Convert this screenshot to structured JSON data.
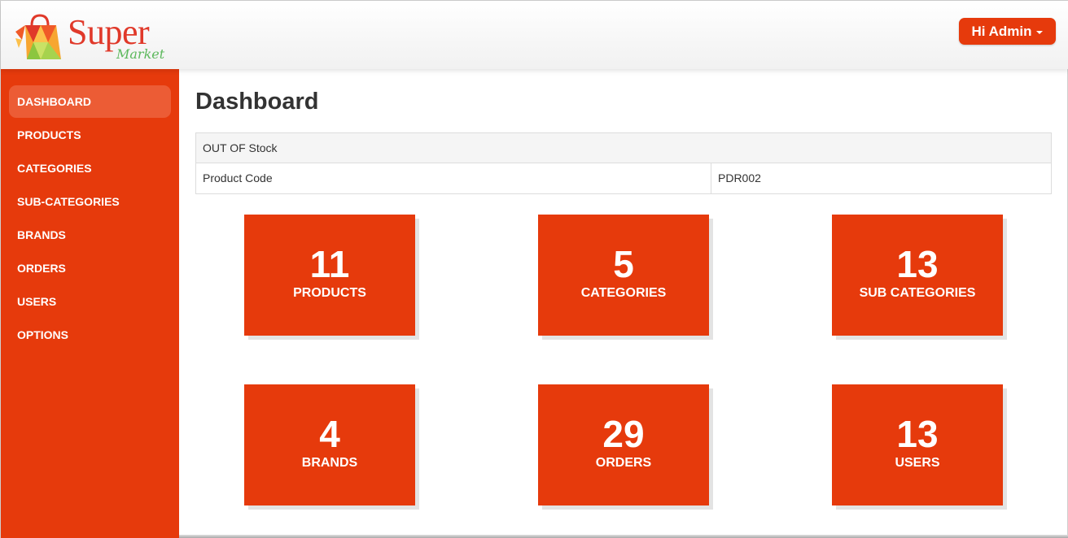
{
  "header": {
    "logo_super": "Super",
    "logo_market": "Market",
    "user_button": "Hi Admin"
  },
  "sidebar": {
    "items": [
      {
        "label": "DASHBOARD",
        "active": true
      },
      {
        "label": "PRODUCTS",
        "active": false
      },
      {
        "label": "CATEGORIES",
        "active": false
      },
      {
        "label": "SUB-CATEGORIES",
        "active": false
      },
      {
        "label": "BRANDS",
        "active": false
      },
      {
        "label": "ORDERS",
        "active": false
      },
      {
        "label": "USERS",
        "active": false
      },
      {
        "label": "OPTIONS",
        "active": false
      }
    ]
  },
  "main": {
    "title": "Dashboard",
    "stock_table": {
      "heading": "OUT OF Stock",
      "rows": [
        {
          "label": "Product Code",
          "value": "PDR002"
        }
      ]
    },
    "cards": [
      {
        "count": "11",
        "label": "PRODUCTS"
      },
      {
        "count": "5",
        "label": "CATEGORIES"
      },
      {
        "count": "13",
        "label": "SUB CATEGORIES"
      },
      {
        "count": "4",
        "label": "BRANDS"
      },
      {
        "count": "29",
        "label": "ORDERS"
      },
      {
        "count": "13",
        "label": "USERS"
      }
    ]
  },
  "colors": {
    "accent": "#e63a0c",
    "active_nav": "#ec5c35",
    "logo_red": "#e0392a",
    "logo_green": "#5cb85c"
  }
}
